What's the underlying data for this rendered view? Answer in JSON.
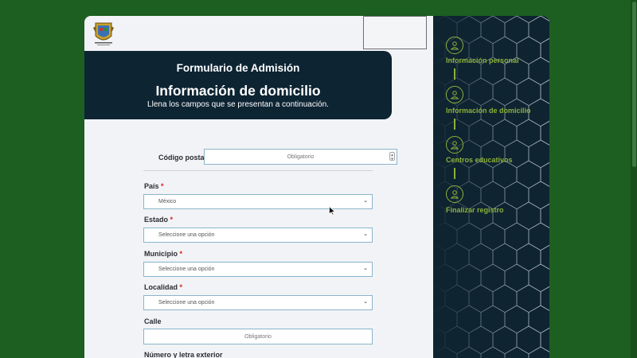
{
  "header": {
    "form_title": "Formulario de Admisión",
    "section_title": "Información de domicilio",
    "subtitle": "Llena los campos que se presentan a continuación."
  },
  "form": {
    "postal_code": {
      "label": "Código postal",
      "required": "*",
      "placeholder": "Obligatorio"
    },
    "country": {
      "label": "País",
      "required": "*",
      "value": "México"
    },
    "state": {
      "label": "Estado",
      "required": "*",
      "value": "Seleccione una opción"
    },
    "municipality": {
      "label": "Municipio",
      "required": "*",
      "value": "Seleccione una opción"
    },
    "locality": {
      "label": "Localidad",
      "required": "*",
      "value": "Seleccione una opción"
    },
    "street": {
      "label": "Calle",
      "placeholder": "Obligatorio"
    },
    "exterior_number": {
      "label": "Número y letra exterior"
    }
  },
  "steps": [
    {
      "label": "Información personal",
      "icon": "user-icon"
    },
    {
      "label": "Información de domicilio",
      "icon": "user-icon"
    },
    {
      "label": "Centros educativos",
      "icon": "user-icon"
    },
    {
      "label": "Finalizar registro",
      "icon": "user-icon"
    }
  ],
  "colors": {
    "background": "#1d5e21",
    "banner": "#0d2433",
    "sidebar": "#0e2431",
    "step_accent": "#8bb13a",
    "required": "#d32020",
    "field_border": "#8ab4cc"
  }
}
